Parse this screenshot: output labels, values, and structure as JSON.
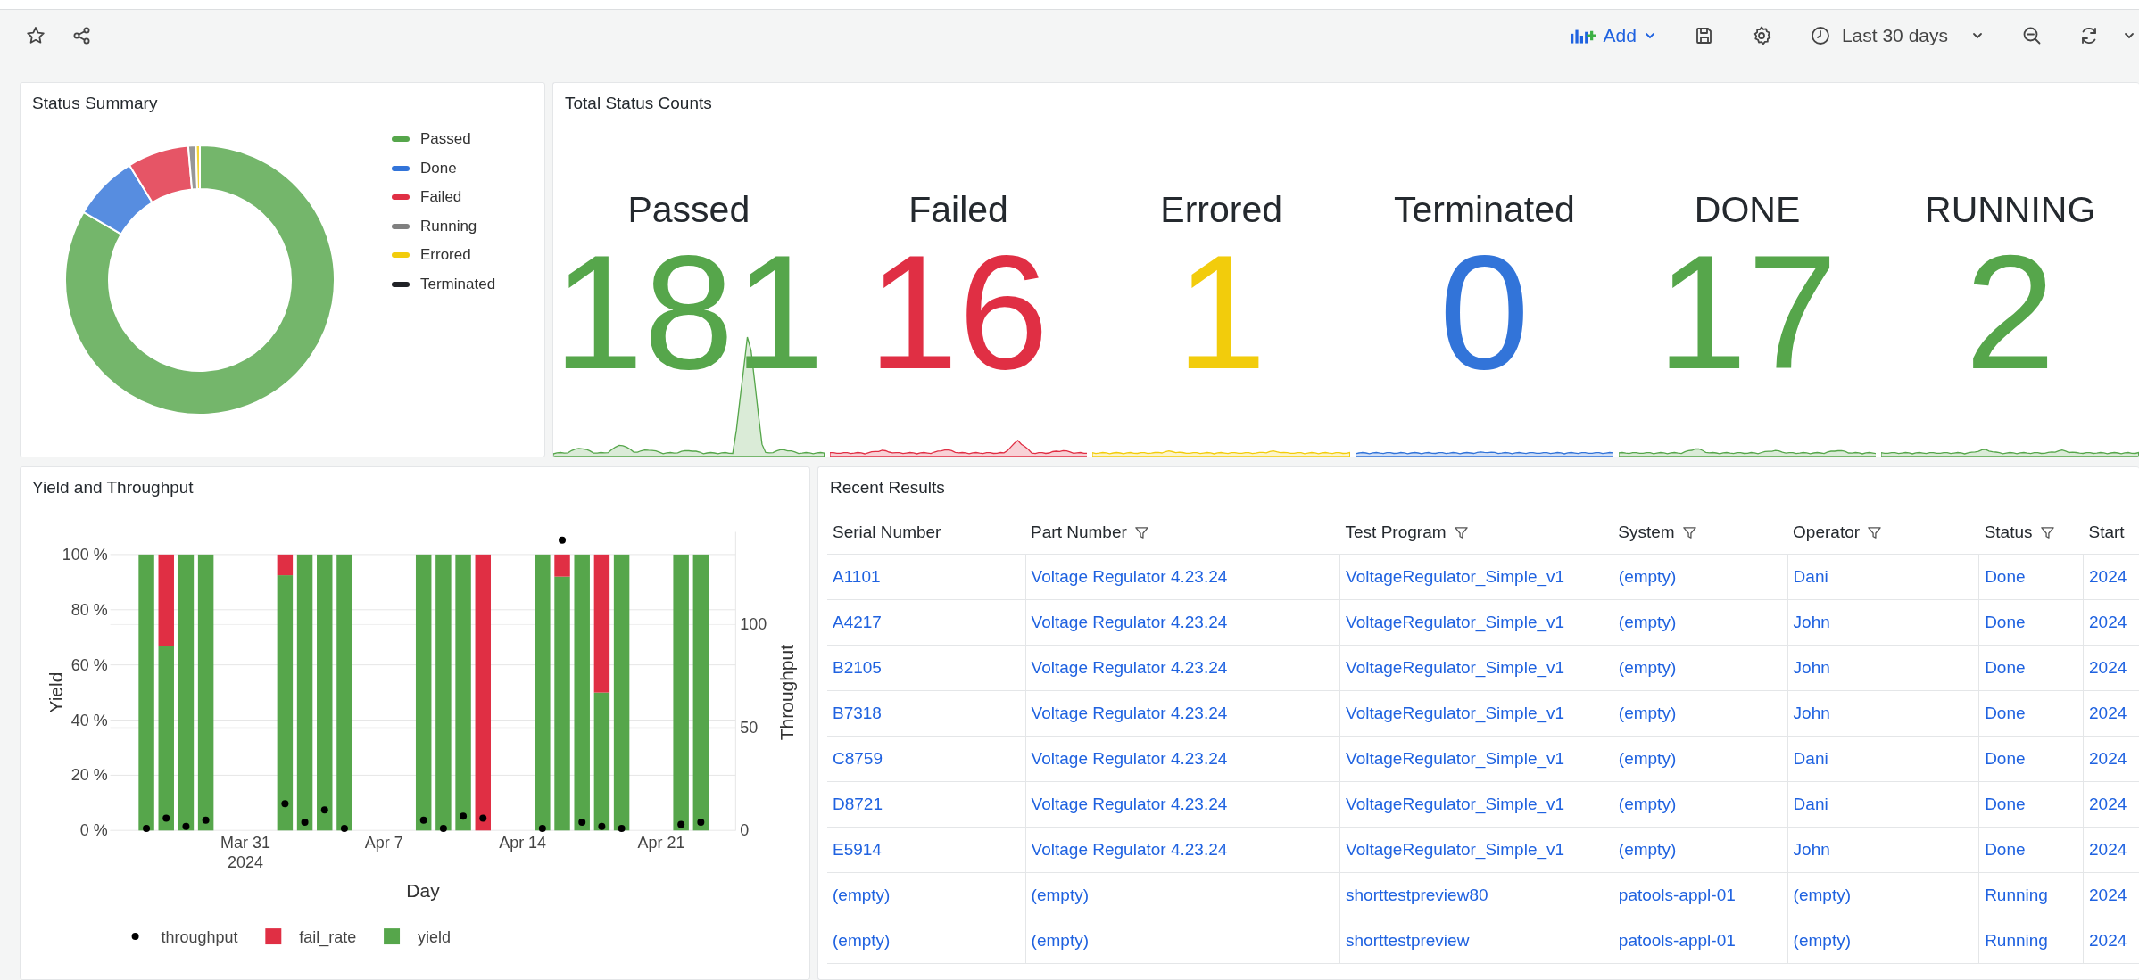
{
  "toolbar": {
    "add_label": "Add",
    "time_range": "Last 30 days"
  },
  "status_summary": {
    "title": "Status Summary",
    "chart_data": {
      "type": "donut",
      "categories": [
        "Passed",
        "Done",
        "Failed",
        "Running",
        "Errored",
        "Terminated"
      ],
      "values": [
        83.41,
        7.83,
        7.37,
        0.92,
        0.47,
        0
      ],
      "colors": [
        "#56a64b",
        "#3274d9",
        "#e02f44",
        "#808080",
        "#f2cc0c",
        "#202226"
      ]
    }
  },
  "total_status_counts": {
    "title": "Total Status Counts",
    "stats": [
      {
        "label": "Passed",
        "value": "181",
        "color": "#56a64b"
      },
      {
        "label": "Failed",
        "value": "16",
        "color": "#e02f44"
      },
      {
        "label": "Errored",
        "value": "1",
        "color": "#f2cc0c"
      },
      {
        "label": "Terminated",
        "value": "0",
        "color": "#3274d9"
      },
      {
        "label": "DONE",
        "value": "17",
        "color": "#56a64b"
      },
      {
        "label": "RUNNING",
        "value": "2",
        "color": "#56a64b"
      }
    ]
  },
  "yield_and_throughput": {
    "title": "Yield and Throughput",
    "charts": [
      {
        "chart_data": {
          "type": "bar",
          "stacked": true,
          "grid": true,
          "xlabel": "Day",
          "ylabel": "Yield",
          "categories": [
            null,
            null,
            null,
            null,
            null,
            "Mar 31\n2024",
            null,
            null,
            null,
            null,
            null,
            null,
            "Apr 7",
            null,
            null,
            null,
            null,
            null,
            null,
            "Apr 14",
            null,
            null,
            null,
            null,
            null,
            null,
            "Apr 21",
            null,
            null
          ],
          "ylim": [
            0,
            100
          ],
          "yticks": [
            {
              "value": 0,
              "label": "0 %"
            },
            {
              "value": 20,
              "label": "20 %"
            },
            {
              "value": 40,
              "label": "40 %"
            },
            {
              "value": 60,
              "label": "60 %"
            },
            {
              "value": 80,
              "label": "80 %"
            },
            {
              "value": 100,
              "label": "100 %"
            }
          ],
          "series": [
            {
              "name": "fail_rate",
              "color": "#e02f44",
              "values": [
                0,
                33,
                0,
                0,
                null,
                null,
                null,
                7.5,
                0,
                0,
                0,
                null,
                null,
                null,
                0,
                0,
                0,
                100,
                null,
                null,
                0,
                8,
                0,
                50,
                0,
                null,
                null,
                0,
                0
              ]
            },
            {
              "name": "yield",
              "color": "#56a64b",
              "values": [
                100,
                67,
                100,
                100,
                null,
                null,
                null,
                92.5,
                100,
                100,
                100,
                null,
                null,
                null,
                100,
                100,
                100,
                0,
                null,
                null,
                100,
                92,
                100,
                50,
                100,
                null,
                null,
                100,
                100
              ]
            }
          ]
        }
      },
      {
        "chart_data": {
          "type": "scatter",
          "grid": true,
          "ylabel": "Throughput",
          "categories": [
            null,
            null,
            null,
            null,
            null,
            null,
            null,
            null,
            null,
            null,
            null,
            null,
            null,
            null,
            null,
            null,
            null,
            null,
            null,
            null,
            null,
            null,
            null,
            null,
            null,
            null,
            null,
            null,
            null
          ],
          "ylim": [
            0,
            145
          ],
          "yticks": [
            0,
            50,
            100
          ],
          "series": [
            {
              "name": "throughput",
              "color": "#000000",
              "values": [
                1,
                6,
                2,
                5,
                null,
                null,
                null,
                13,
                4,
                10,
                1,
                null,
                null,
                null,
                5,
                1,
                7,
                6,
                null,
                null,
                1,
                141,
                4,
                2,
                1,
                null,
                null,
                3,
                4
              ]
            }
          ]
        }
      }
    ]
  },
  "recent_results": {
    "title": "Recent Results",
    "columns": [
      {
        "label": "Serial Number",
        "filter": false
      },
      {
        "label": "Part Number",
        "filter": true
      },
      {
        "label": "Test Program",
        "filter": true
      },
      {
        "label": "System",
        "filter": true
      },
      {
        "label": "Operator",
        "filter": true
      },
      {
        "label": "Status",
        "filter": true
      },
      {
        "label": "Start",
        "filter": false
      }
    ],
    "rows": [
      [
        "A1101",
        "Voltage Regulator 4.23.24",
        "VoltageRegulator_Simple_v1",
        "(empty)",
        "Dani",
        "Done",
        "2024"
      ],
      [
        "A4217",
        "Voltage Regulator 4.23.24",
        "VoltageRegulator_Simple_v1",
        "(empty)",
        "John",
        "Done",
        "2024"
      ],
      [
        "B2105",
        "Voltage Regulator 4.23.24",
        "VoltageRegulator_Simple_v1",
        "(empty)",
        "John",
        "Done",
        "2024"
      ],
      [
        "B7318",
        "Voltage Regulator 4.23.24",
        "VoltageRegulator_Simple_v1",
        "(empty)",
        "John",
        "Done",
        "2024"
      ],
      [
        "C8759",
        "Voltage Regulator 4.23.24",
        "VoltageRegulator_Simple_v1",
        "(empty)",
        "Dani",
        "Done",
        "2024"
      ],
      [
        "D8721",
        "Voltage Regulator 4.23.24",
        "VoltageRegulator_Simple_v1",
        "(empty)",
        "Dani",
        "Done",
        "2024"
      ],
      [
        "E5914",
        "Voltage Regulator 4.23.24",
        "VoltageRegulator_Simple_v1",
        "(empty)",
        "John",
        "Done",
        "2024"
      ],
      [
        "(empty)",
        "(empty)",
        "shorttestpreview80",
        "patools-appl-01",
        "(empty)",
        "Running",
        "2024"
      ],
      [
        "(empty)",
        "(empty)",
        "shorttestpreview",
        "patools-appl-01",
        "(empty)",
        "Running",
        "2024"
      ]
    ]
  }
}
